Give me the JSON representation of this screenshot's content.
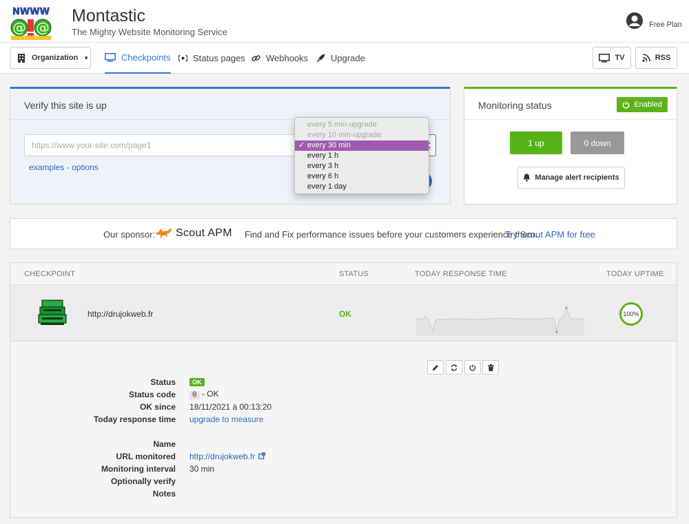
{
  "header": {
    "logo_text": "NWWW",
    "title": "Montastic",
    "subtitle": "The Mighty Website Monitoring Service",
    "plan": "Free Plan"
  },
  "nav": {
    "organization": "Organization",
    "tabs": [
      {
        "label": "Checkpoints",
        "active": true
      },
      {
        "label": "Status pages"
      },
      {
        "label": "Webhooks"
      },
      {
        "label": "Upgrade"
      }
    ],
    "tv": "TV",
    "rss": "RSS"
  },
  "verify": {
    "title": "Verify this site is up",
    "url_placeholder": "https://www.your-site.com/page1",
    "examples_link": "examples - options",
    "interval_options": [
      {
        "label": "every 5 min-upgrade",
        "disabled": true
      },
      {
        "label": "every 10 min-upgrade",
        "disabled": true
      },
      {
        "label": "every 30 min",
        "selected": true
      },
      {
        "label": "every 1 h"
      },
      {
        "label": "every 3 h"
      },
      {
        "label": "every 6 h"
      },
      {
        "label": "every 1 day"
      }
    ]
  },
  "monitoring": {
    "title": "Monitoring status",
    "enabled": "Enabled",
    "up": "1 up",
    "down": "0 down",
    "alert_button": "Manage alert recipients"
  },
  "sponsor": {
    "label": "Our sponsor:",
    "name": "Scout APM",
    "text": "Find and Fix performance issues before your customers experience them.",
    "link": "Try Scout APM for free",
    "trailing": "."
  },
  "table": {
    "headers": {
      "checkpoint": "CHECKPOINT",
      "status": "STATUS",
      "response": "TODAY RESPONSE TIME",
      "uptime": "TODAY UPTIME"
    },
    "row": {
      "url": "http://drujokweb.fr",
      "status": "OK",
      "uptime": "100%",
      "uptime_fraction": 1.0
    },
    "details": {
      "status_label": "Status",
      "status_value": "OK",
      "code_label": "Status code",
      "code_value": "0",
      "code_suffix": " - OK",
      "since_label": "OK since",
      "since_value": "18/11/2021 à 00:13:20",
      "response_label": "Today response time",
      "response_value": "upgrade to measure",
      "name_label": "Name",
      "url_label": "URL monitored",
      "url_value": "http://drujokweb.fr",
      "interval_label": "Monitoring interval",
      "interval_value": "30 min",
      "verify_label": "Optionally verify",
      "notes_label": "Notes"
    }
  },
  "colors": {
    "accent_blue": "#2a7ae2",
    "green": "#5cb31a",
    "selected_option": "#a05bb0"
  }
}
